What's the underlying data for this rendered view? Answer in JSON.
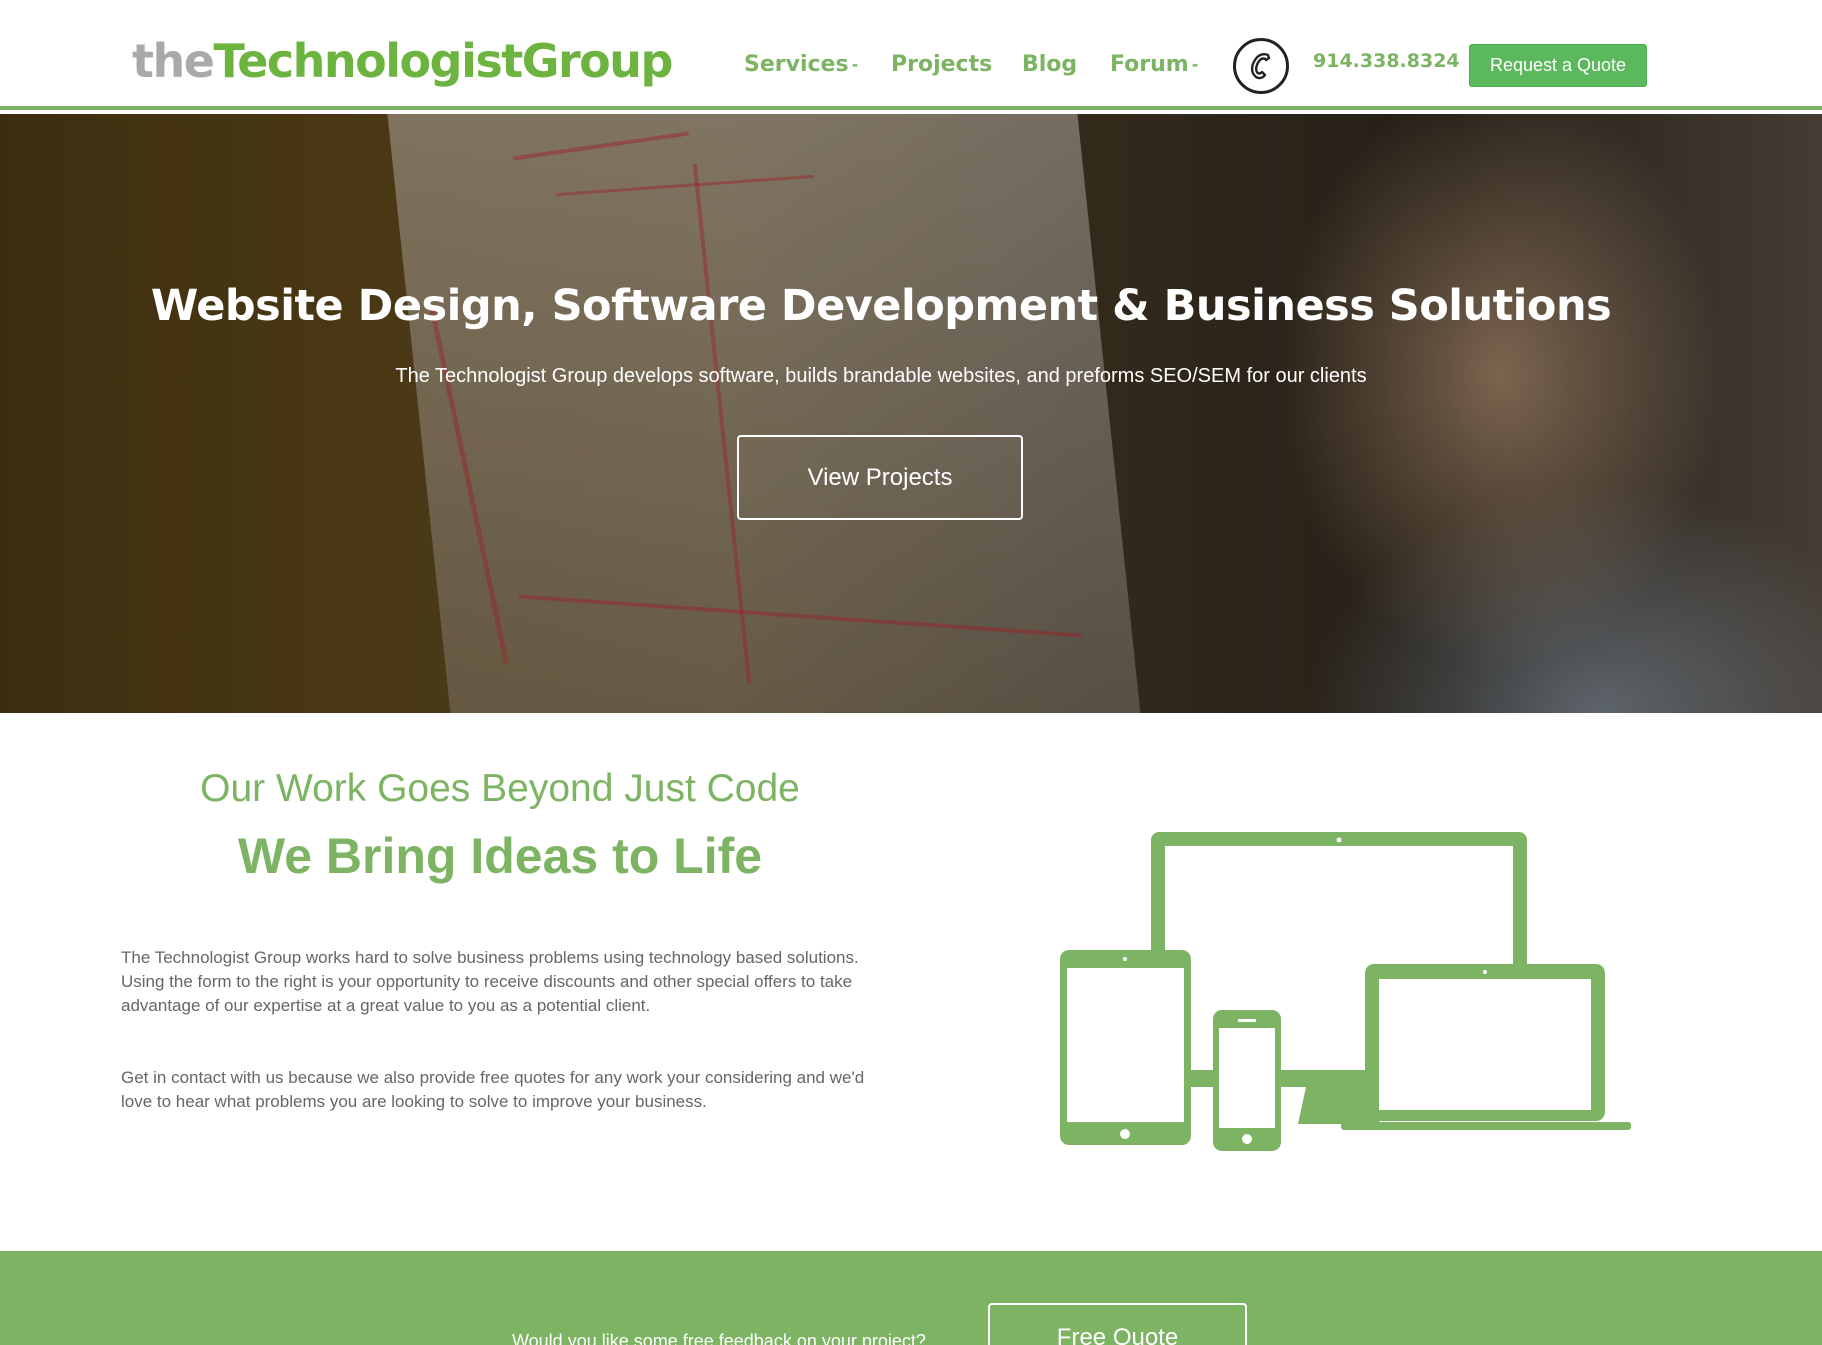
{
  "header": {
    "logo_the": "the",
    "logo_group": "TechnologistGroup",
    "nav": {
      "services": "Services",
      "projects": "Projects",
      "blog": "Blog",
      "forum": "Forum"
    },
    "dropdown_marker": "-",
    "phone": "914.338.8324",
    "quote_button": "Request a Quote"
  },
  "hero": {
    "title": "Website Design, Software Development & Business Solutions",
    "subtitle": "The Technologist Group develops software, builds brandable websites, and preforms SEO/SEM for our clients",
    "button": "View Projects"
  },
  "about": {
    "subheading": "Our Work Goes Beyond Just Code",
    "heading": "We Bring Ideas to Life",
    "paragraph1": "The Technologist Group works hard to solve business problems using technology based solutions. Using the form to the right is your opportunity to receive discounts and other special offers to take advantage of our expertise at a great value to you as a potential client.",
    "paragraph2": "Get in contact with us because we also provide free quotes for any work your considering and we'd love to hear what problems you are looking to solve to improve your business."
  },
  "cta": {
    "question": "Would you like some free feedback on your project?",
    "button": "Free Quote"
  },
  "colors": {
    "brand_green": "#7db463",
    "logo_gray": "#a9a9a9",
    "button_green": "#5cb85c"
  }
}
